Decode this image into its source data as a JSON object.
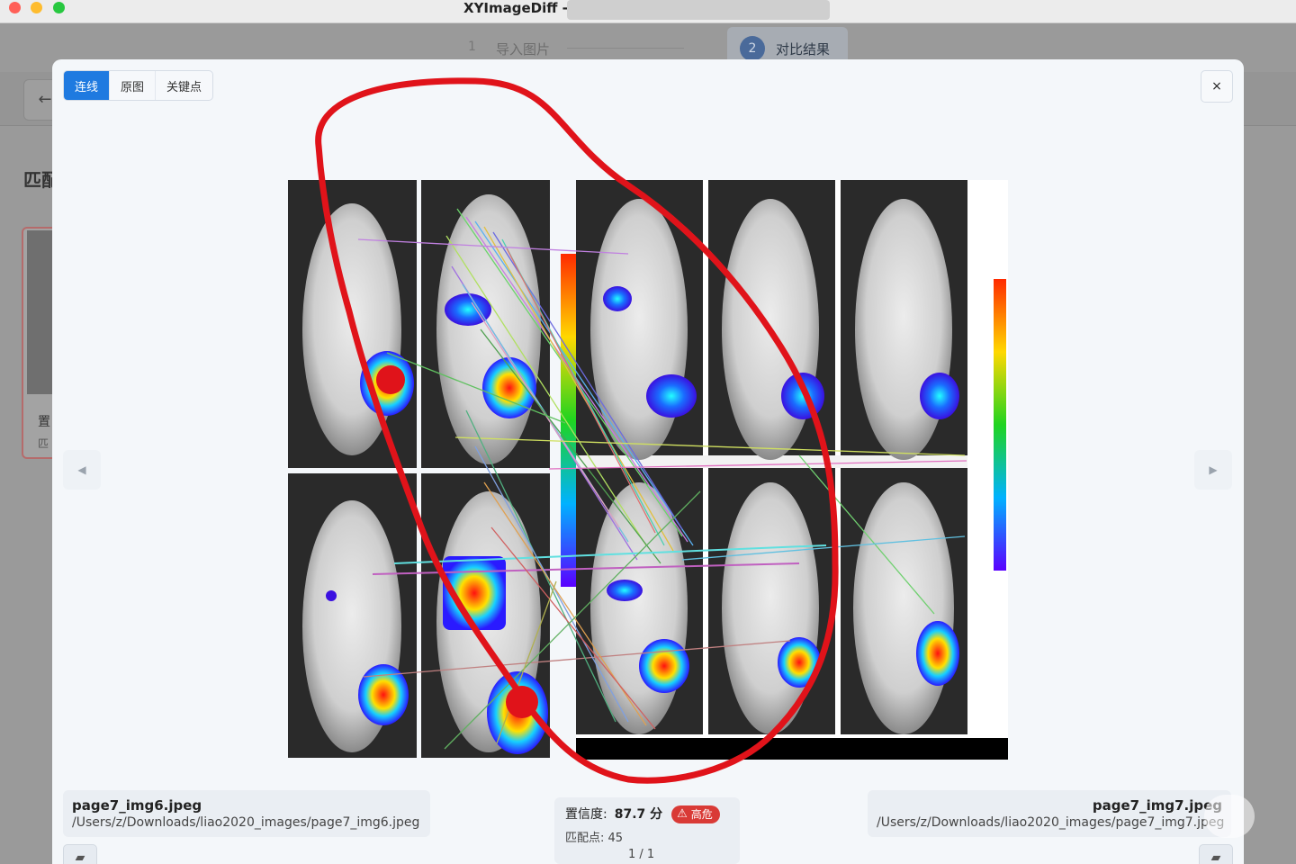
{
  "window": {
    "title": "XYImageDiff -"
  },
  "steps": [
    {
      "num": "1",
      "label": "导入图片"
    },
    {
      "num": "2",
      "label": "对比结果"
    }
  ],
  "background": {
    "back_icon": "←",
    "heading": "匹配",
    "card_label": "置",
    "card_sub": "匹"
  },
  "view_modes": {
    "lines": "连线",
    "original": "原图",
    "keypoints": "关键点",
    "active": "lines"
  },
  "close_label": "×",
  "nav": {
    "prev": "◀",
    "next": "▶"
  },
  "left_image": {
    "filename": "page7_img6.jpeg",
    "path": "/Users/z/Downloads/liao2020_images/page7_img6.jpeg"
  },
  "right_image": {
    "filename": "page7_img7.jpeg",
    "path": "/Users/z/Downloads/liao2020_images/page7_img7.jpeg"
  },
  "result": {
    "confidence_label": "置信度:",
    "confidence_value": "87.7 分",
    "risk_icon": "warning-triangle-icon",
    "risk_label": "高危",
    "matches_label": "匹配点: 45",
    "pager": "1 / 1"
  },
  "colors": {
    "accent": "#1f7ae0",
    "danger": "#d93a36",
    "annotation": "#e0131a"
  }
}
